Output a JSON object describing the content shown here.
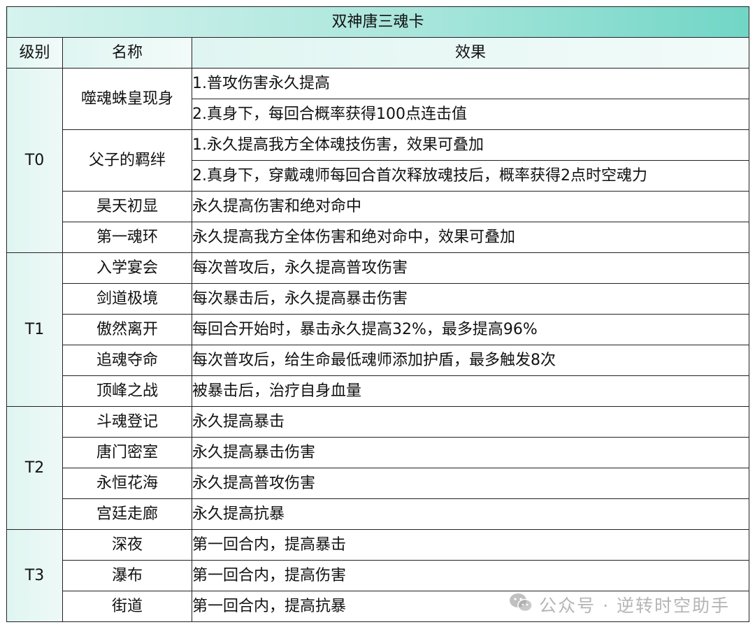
{
  "table": {
    "title": "双神唐三魂卡",
    "headers": {
      "tier": "级别",
      "name": "名称",
      "effect": "效果"
    },
    "groups": [
      {
        "tier": "T0",
        "cards": [
          {
            "name": "噬魂蛛皇现身",
            "effects": [
              "1.普攻伤害永久提高",
              "2.真身下，每回合概率获得100点连击值"
            ]
          },
          {
            "name": "父子的羁绊",
            "effects": [
              "1.永久提高我方全体魂技伤害，效果可叠加",
              "2.真身下，穿戴魂师每回合首次释放魂技后，概率获得2点时空魂力"
            ]
          },
          {
            "name": "昊天初显",
            "effects": [
              "永久提高伤害和绝对命中"
            ]
          },
          {
            "name": "第一魂环",
            "effects": [
              "永久提高我方全体伤害和绝对命中，效果可叠加"
            ]
          }
        ]
      },
      {
        "tier": "T1",
        "cards": [
          {
            "name": "入学宴会",
            "effects": [
              "每次普攻后，永久提高普攻伤害"
            ]
          },
          {
            "name": "剑道极境",
            "effects": [
              "每次暴击后，永久提高暴击伤害"
            ]
          },
          {
            "name": "傲然离开",
            "effects": [
              "每回合开始时，暴击永久提高32%，最多提高96%"
            ]
          },
          {
            "name": "追魂夺命",
            "effects": [
              "每次普攻后，给生命最低魂师添加护盾，最多触发8次"
            ]
          },
          {
            "name": "顶峰之战",
            "effects": [
              "被暴击后，治疗自身血量"
            ]
          }
        ]
      },
      {
        "tier": "T2",
        "cards": [
          {
            "name": "斗魂登记",
            "effects": [
              "永久提高暴击"
            ]
          },
          {
            "name": "唐门密室",
            "effects": [
              "永久提高暴击伤害"
            ]
          },
          {
            "name": "永恒花海",
            "effects": [
              "永久提高普攻伤害"
            ]
          },
          {
            "name": "宫廷走廊",
            "effects": [
              "永久提高抗暴"
            ]
          }
        ]
      },
      {
        "tier": "T3",
        "cards": [
          {
            "name": "深夜",
            "effects": [
              "第一回合内，提高暴击"
            ]
          },
          {
            "name": "瀑布",
            "effects": [
              "第一回合内，提高伤害"
            ]
          },
          {
            "name": "街道",
            "effects": [
              "第一回合内，提高抗暴"
            ]
          }
        ]
      }
    ]
  },
  "watermark": {
    "text": "公众号 · 逆转时空助手",
    "icon": "wechat-icon"
  },
  "colors": {
    "title_bg_end": "#71d6c6",
    "header_bg": "#dff5f1",
    "border": "#222222"
  }
}
